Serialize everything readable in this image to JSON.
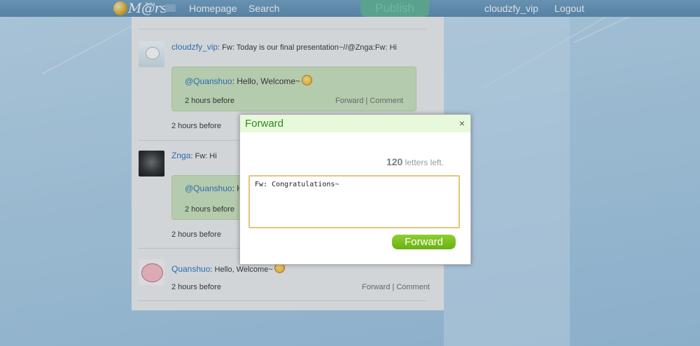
{
  "nav": {
    "logo_text": "M@rs",
    "logo_badge": "beta",
    "homepage": "Homepage",
    "search": "Search",
    "publish": "Publish",
    "username": "cloudzfy_vip",
    "logout": "Logout"
  },
  "feed": {
    "posts": [
      {
        "author": "cloudzfy_vip",
        "text": ": Fw: Today is our final presentation~//@Znga:Fw: Hi",
        "quote": {
          "author": "@Quanshuo",
          "text": ": Hello, Welcome~",
          "time": "2 hours before",
          "forward": "Forward",
          "sep": " | ",
          "comment": "Comment"
        },
        "time": "2 hours before"
      },
      {
        "author": "Znga",
        "text": ": Fw: Hi",
        "quote": {
          "author": "@Quanshuo",
          "text": ": He",
          "time": "2 hours before"
        },
        "time": "2 hours before"
      },
      {
        "author": "Quanshuo",
        "text": ": Hello, Welcome~",
        "time": "2 hours before",
        "forward": "Forward",
        "sep": " | ",
        "comment": "Comment"
      }
    ]
  },
  "dialog": {
    "title": "Forward",
    "close": "×",
    "count": "120",
    "count_suffix": " letters left.",
    "text": "Fw: Congratulations~",
    "button": "Forward"
  },
  "icons": [
    "camera-icon",
    "close-icon",
    "smiley-icon"
  ]
}
